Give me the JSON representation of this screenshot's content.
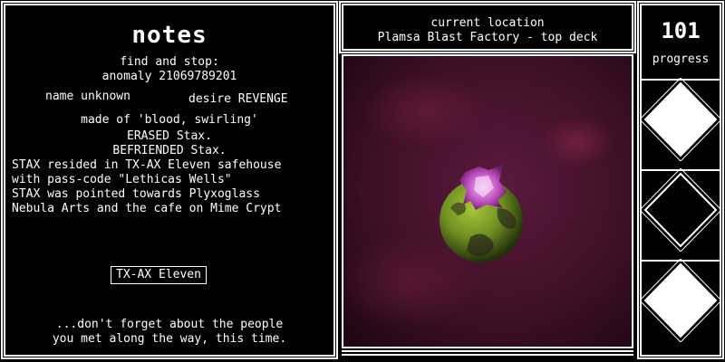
{
  "notes": {
    "title": "notes",
    "find_line1": "find and stop:",
    "find_line2": "anomaly 21069789201",
    "name_field": "name unknown",
    "desire_field": "desire REVENGE",
    "made_of": "made of 'blood, swirling'",
    "erased": "ERASED Stax.",
    "befriended": "BEFRIENDED Stax.",
    "log_lines": [
      "STAX resided in TX-AX Eleven safehouse",
      "with pass-code \"Lethicas Wells\"",
      "STAX was pointed towards Plyxoglass",
      "Nebula Arts and the cafe on Mime Crypt"
    ],
    "tag_button": "TX-AX Eleven",
    "footer_line1": "...don't forget about the people",
    "footer_line2": "you met along the way, this time."
  },
  "location": {
    "heading": "current location",
    "name": "Plamsa Blast Factory - top deck"
  },
  "progress": {
    "value": "101",
    "label": "progress",
    "diamonds": [
      "filled",
      "outline",
      "filled"
    ]
  },
  "scene": {
    "background_color": "#4a1430",
    "planet_color": "#7a9a2a",
    "creature_color": "#c050c0"
  }
}
